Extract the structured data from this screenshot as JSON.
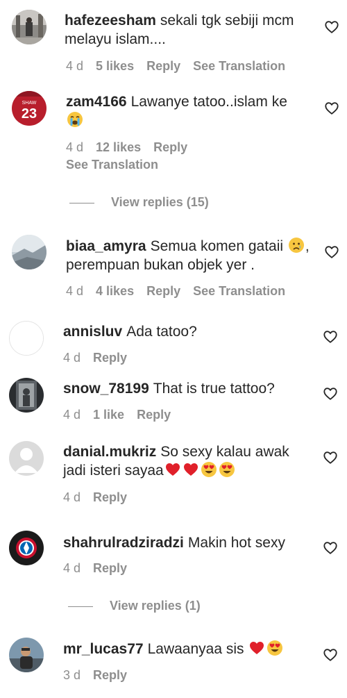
{
  "comments": [
    {
      "username": "hafezeesham",
      "text": "sekali tgk sebiji mcm melayu islam....",
      "time": "4 d",
      "likes": "5 likes",
      "reply": "Reply",
      "translate": "See Translation"
    },
    {
      "username": "zam4166",
      "text": "Lawanye tatoo..islam ke",
      "emoji_after": [
        "crying-face"
      ],
      "time": "4 d",
      "likes": "12 likes",
      "reply": "Reply",
      "translate": "See Translation",
      "avatar_jersey_name": "SHAW",
      "avatar_jersey_number": "23",
      "view_replies": "View replies (15)"
    },
    {
      "username": "biaa_amyra",
      "text_a": "Semua komen gataii",
      "emoji_mid": [
        "sad-tear-face"
      ],
      "text_b": ", perempuan bukan objek yer .",
      "time": "4 d",
      "likes": "4 likes",
      "reply": "Reply",
      "translate": "See Translation"
    },
    {
      "username": "annisluv",
      "text": "Ada tatoo?",
      "time": "4 d",
      "reply": "Reply"
    },
    {
      "username": "snow_78199",
      "text": "That is true tattoo?",
      "time": "4 d",
      "likes": "1 like",
      "reply": "Reply"
    },
    {
      "username": "danial.mukriz",
      "text": "So sexy kalau awak jadi isteri sayaa",
      "emoji_after": [
        "red-heart",
        "red-heart",
        "heart-eyes-face",
        "heart-eyes-face"
      ],
      "time": "4 d",
      "reply": "Reply"
    },
    {
      "username": "shahrulradziradzi",
      "text": "Makin hot sexy",
      "time": "4 d",
      "reply": "Reply",
      "view_replies": "View replies (1)"
    },
    {
      "username": "mr_lucas77",
      "text": "Lawaanyaa sis",
      "emoji_after": [
        "red-heart",
        "heart-eyes-face"
      ],
      "time": "3 d",
      "reply": "Reply"
    }
  ],
  "colors": {
    "text": "#262626",
    "secondary": "#8e8e8e",
    "emoji_heart": "#e0202a",
    "emoji_face": "#f7c640"
  },
  "icons": {
    "like": "heart-outline-icon"
  }
}
